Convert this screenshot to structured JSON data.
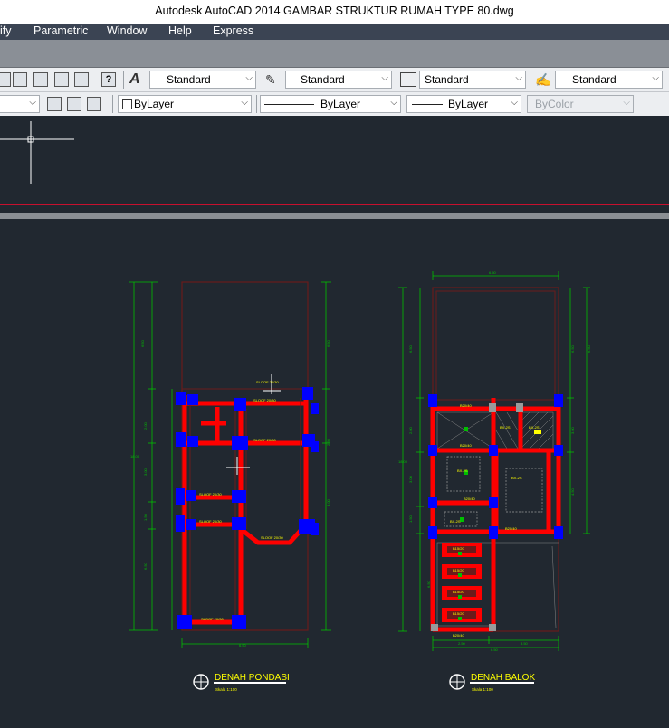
{
  "app": {
    "title": "Autodesk AutoCAD 2014    GAMBAR STRUKTUR RUMAH TYPE 80.dwg"
  },
  "menu": {
    "items": [
      "ify",
      "Parametric",
      "Window",
      "Help",
      "Express"
    ]
  },
  "toolbar": {
    "text_style": "Standard",
    "dim_style": "Standard",
    "table_style": "Standard",
    "mleader_style": "Standard"
  },
  "properties": {
    "color": "ByLayer",
    "linetype": "ByLayer",
    "lineweight": "ByLayer",
    "plotstyle": "ByColor"
  },
  "drawing": {
    "left_plan": {
      "title": "DENAH PONDASI",
      "scale": "Skala 1:100"
    },
    "right_plan": {
      "title": "DENAH BALOK",
      "scale": "Skala 1:100"
    },
    "left_dims": {
      "total": "18.00",
      "seg1": "6.50",
      "seg2": "2.00",
      "seg2b": "1.00",
      "seg3": "3.00",
      "seg4": "1.50",
      "seg5": "6.50",
      "bottom": "6.50",
      "right_top": "6.50",
      "right_mid": "2.50",
      "right_low": "3.00"
    },
    "right_dims": {
      "top": "6.50",
      "total": "18.00",
      "seg1": "6.50",
      "seg2": "2.00",
      "seg3": "3.00",
      "seg4": "1.50",
      "seg5": "6.50",
      "right1": "6.50",
      "right2": "3.00",
      "right3": "4.50",
      "right4": "6.50",
      "bottom_left": "2.50",
      "bottom_right": "3.50",
      "bottom_total": "6.50"
    },
    "labels": {
      "sloof_1": "SLOOF 20/30",
      "sloof_2": "SLOOF 15/20",
      "balok_1": "B20/40",
      "balok_2": "B15/20",
      "ring": "RB 15/20",
      "bx": "BX-2S",
      "tb": "T20/20"
    },
    "colors": {
      "bg": "#212830",
      "beam": "#ff0000",
      "column": "#0000ff",
      "dim": "#00c000",
      "outline": "#6a1b1b",
      "text": "#ffff00",
      "white": "#ffffff"
    }
  }
}
